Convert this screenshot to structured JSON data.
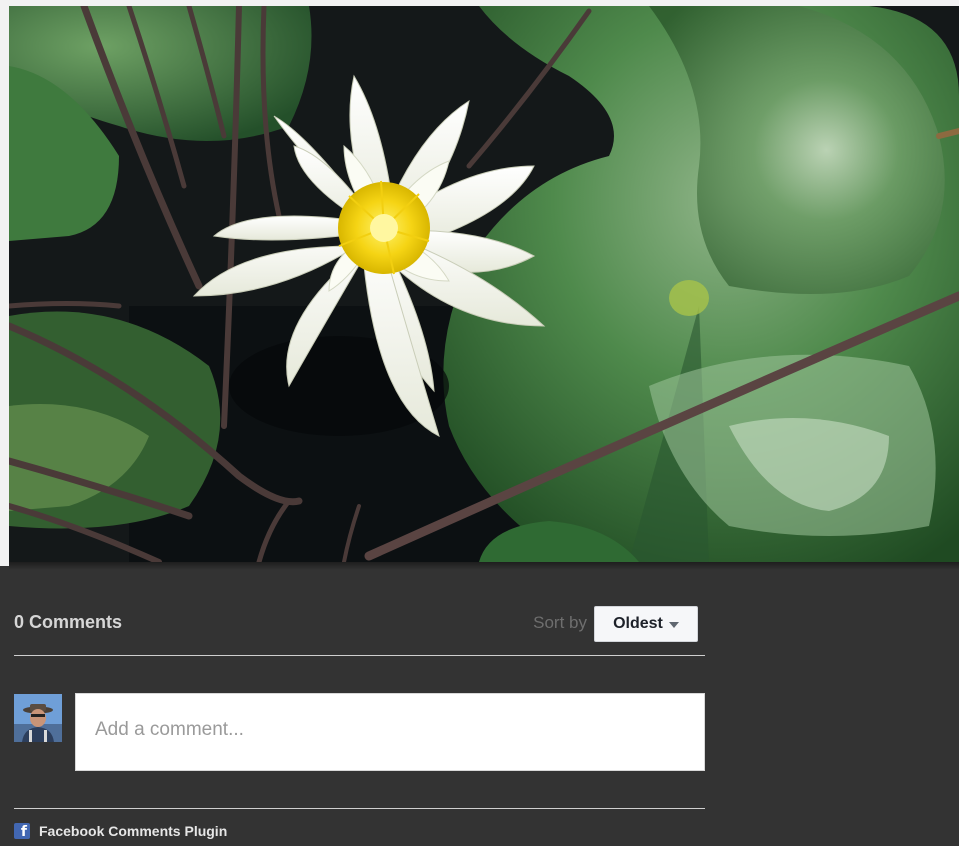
{
  "comments": {
    "count_label": "0 Comments",
    "sort_label": "Sort by",
    "sort_selected": "Oldest",
    "input_placeholder": "Add a comment...",
    "plugin_label": "Facebook Comments Plugin",
    "fb_glyph": "f"
  },
  "colors": {
    "background": "#333333",
    "facebook_blue": "#4267b2",
    "text_light": "#d6d6d6"
  }
}
